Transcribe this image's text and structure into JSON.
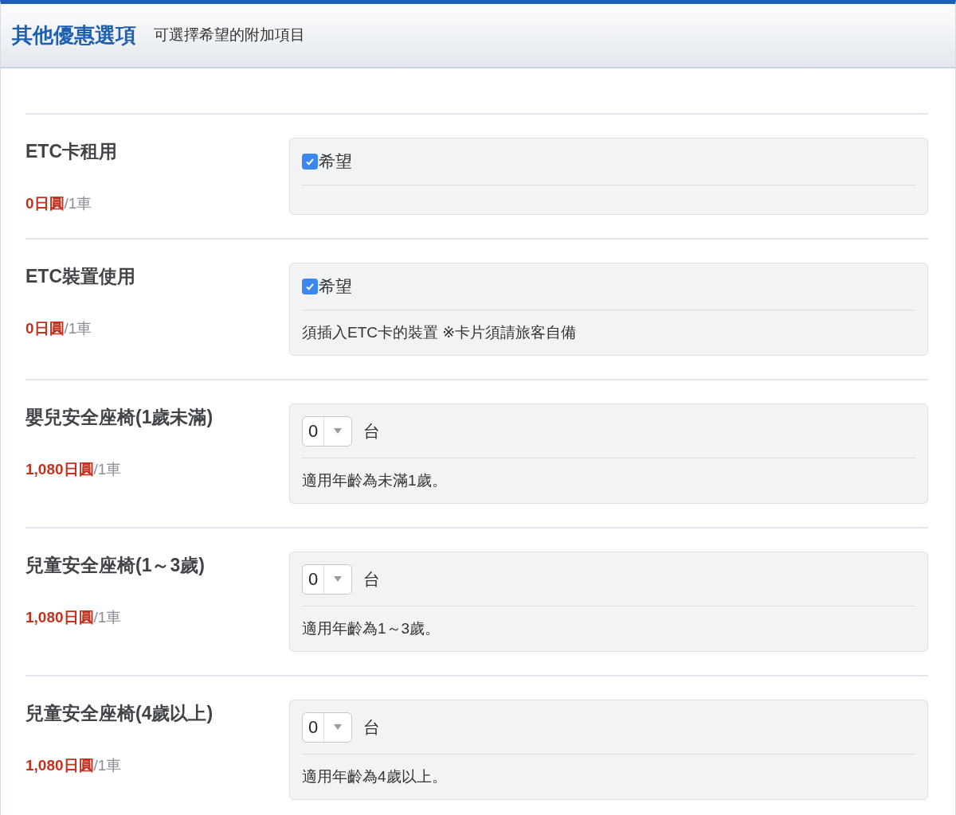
{
  "header": {
    "title": "其他優惠選項",
    "subtitle": "可選擇希望的附加項目"
  },
  "options": [
    {
      "kind": "checkbox",
      "name": "ETC卡租用",
      "price": "0日圓",
      "unit": "/1車",
      "label": "希望",
      "checked": true
    },
    {
      "kind": "checkbox",
      "name": "ETC裝置使用",
      "price": "0日圓",
      "unit": "/1車",
      "label": "希望",
      "checked": true,
      "note": "須插入ETC卡的裝置 ※卡片須請旅客自備"
    },
    {
      "kind": "select",
      "name": "嬰兒安全座椅(1歲未滿)",
      "price": "1,080日圓",
      "unit": "/1車",
      "value": "0",
      "suffix": "台",
      "note": "適用年齡為未滿1歲。"
    },
    {
      "kind": "select",
      "name": "兒童安全座椅(1～3歲)",
      "price": "1,080日圓",
      "unit": "/1車",
      "value": "0",
      "suffix": "台",
      "note": "適用年齡為1～3歲。"
    },
    {
      "kind": "select",
      "name": "兒童安全座椅(4歲以上)",
      "price": "1,080日圓",
      "unit": "/1車",
      "value": "0",
      "suffix": "台",
      "note": "適用年齡為4歲以上。"
    }
  ]
}
